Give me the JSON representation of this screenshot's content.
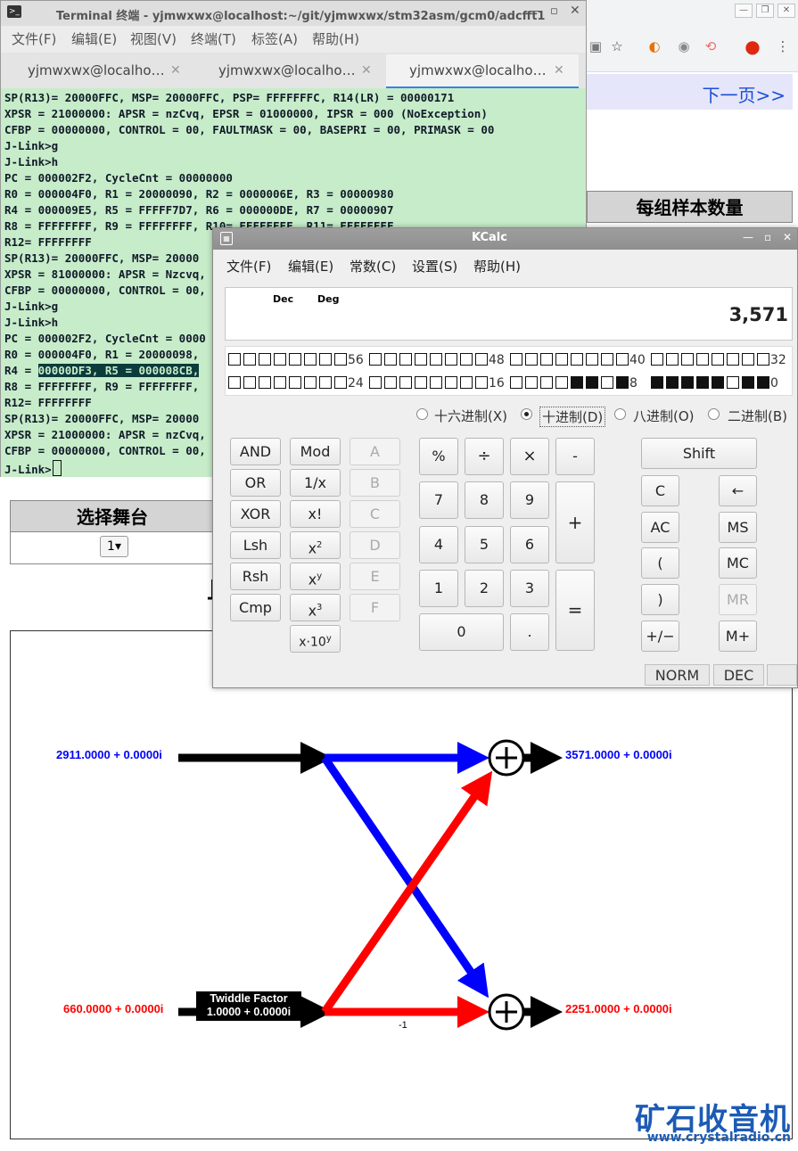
{
  "browser": {
    "next_page": "下一页>>",
    "samples_header": "每组样本数量",
    "stage_header": "选择舞台",
    "stage_value": "1",
    "partial_heading": "且",
    "butterfly": {
      "input_top": "2911.0000 + 0.0000i",
      "input_bottom": "660.0000 + 0.0000i",
      "output_top": "3571.0000 + 0.0000i",
      "output_bottom": "2251.0000 + 0.0000i",
      "twiddle_title": "Twiddle Factor",
      "twiddle_value": "1.0000 + 0.0000i",
      "minus_one": "-1",
      "colors": {
        "blue": "#0000ff",
        "red": "#ff0000",
        "black": "#000000"
      }
    },
    "watermark_cn": "矿石收音机",
    "watermark_url": "www.crystalradio.cn"
  },
  "terminal": {
    "title": "Terminal 终端 - yjmwxwx@localhost:~/git/yjmwxwx/stm32asm/gcm0/adcfft1",
    "menu": [
      "文件(F)",
      "编辑(E)",
      "视图(V)",
      "终端(T)",
      "标签(A)",
      "帮助(H)"
    ],
    "tabs": [
      "yjmwxwx@localho…",
      "yjmwxwx@localho…",
      "yjmwxwx@localho…"
    ],
    "lines": [
      "SP(R13)= 20000FFC, MSP= 20000FFC, PSP= FFFFFFFC, R14(LR) = 00000171",
      "XPSR = 21000000: APSR = nzCvq, EPSR = 01000000, IPSR = 000 (NoException)",
      "CFBP = 00000000, CONTROL = 00, FAULTMASK = 00, BASEPRI = 00, PRIMASK = 00",
      "J-Link>g",
      "J-Link>h",
      "PC = 000002F2, CycleCnt = 00000000",
      "R0 = 000004F0, R1 = 20000090, R2 = 0000006E, R3 = 00000980",
      "R4 = 000009E5, R5 = FFFFF7D7, R6 = 000000DE, R7 = 00000907",
      "R8 = FFFFFFFF, R9 = FFFFFFFF, R10= FFFFFFFF, R11= FFFFFFFF",
      "R12= FFFFFFFF",
      "SP(R13)= 20000FFC, MSP= 20000",
      "XPSR = 81000000: APSR = Nzcvq,",
      "CFBP = 00000000, CONTROL = 00,",
      "J-Link>g",
      "J-Link>h",
      "PC = 000002F2, CycleCnt = 0000",
      "R0 = 000004F0, R1 = 20000098,",
      "R4 = ",
      "R8 = FFFFFFFF, R9 = FFFFFFFF,",
      "R12= FFFFFFFF",
      "SP(R13)= 20000FFC, MSP= 20000",
      "XPSR = 21000000: APSR = nzCvq,",
      "CFBP = 00000000, CONTROL = 00,",
      "J-Link>"
    ],
    "selected_text": "00000DF3, R5 = 000008CB,"
  },
  "kcalc": {
    "title": "KCalc",
    "menu": [
      "文件(F)",
      "编辑(E)",
      "常数(C)",
      "设置(S)",
      "帮助(H)"
    ],
    "display": {
      "mode1": "Dec",
      "mode2": "Deg",
      "value": "3,571"
    },
    "bit_rows": [
      {
        "groups": [
          {
            "label": "56",
            "bits": "00000000"
          },
          {
            "label": "48",
            "bits": "00000000"
          },
          {
            "label": "40",
            "bits": "00000000"
          },
          {
            "label": "32",
            "bits": "00000000"
          }
        ]
      },
      {
        "groups": [
          {
            "label": "24",
            "bits": "00000000"
          },
          {
            "label": "16",
            "bits": "00000000"
          },
          {
            "label": "8",
            "bits": "00001101"
          },
          {
            "label": "0",
            "bits": "11111011"
          }
        ]
      }
    ],
    "bases": [
      "十六进制(X)",
      "十进制(D)",
      "八进制(O)",
      "二进制(B)"
    ],
    "selected_base": "十进制(D)",
    "buttons": {
      "and": "AND",
      "or": "OR",
      "xor": "XOR",
      "lsh": "Lsh",
      "rsh": "Rsh",
      "cmp": "Cmp",
      "mod": "Mod",
      "inv": "1/x",
      "fact": "x!",
      "sq": "x",
      "sq_sup": "2",
      "pow": "x",
      "pow_sup": "y",
      "cube": "x",
      "cube_sup": "3",
      "exp": "x·10",
      "exp_sup": "y",
      "hex_a": "A",
      "hex_b": "B",
      "hex_c": "C",
      "hex_d": "D",
      "hex_e": "E",
      "hex_f": "F",
      "percent": "%",
      "divide": "÷",
      "multiply": "×",
      "minus": "-",
      "plus": "+",
      "equals": "=",
      "d7": "7",
      "d8": "8",
      "d9": "9",
      "d4": "4",
      "d5": "5",
      "d6": "6",
      "d1": "1",
      "d2": "2",
      "d3": "3",
      "d0": "0",
      "dot": ".",
      "shift": "Shift",
      "clear": "C",
      "backspace": "←",
      "allclear": "AC",
      "ms": "MS",
      "lparen": "(",
      "mc": "MC",
      "rparen": ")",
      "mr": "MR",
      "sign": "+/−",
      "mplus": "M+"
    },
    "status": {
      "norm": "NORM",
      "dec": "DEC"
    }
  }
}
